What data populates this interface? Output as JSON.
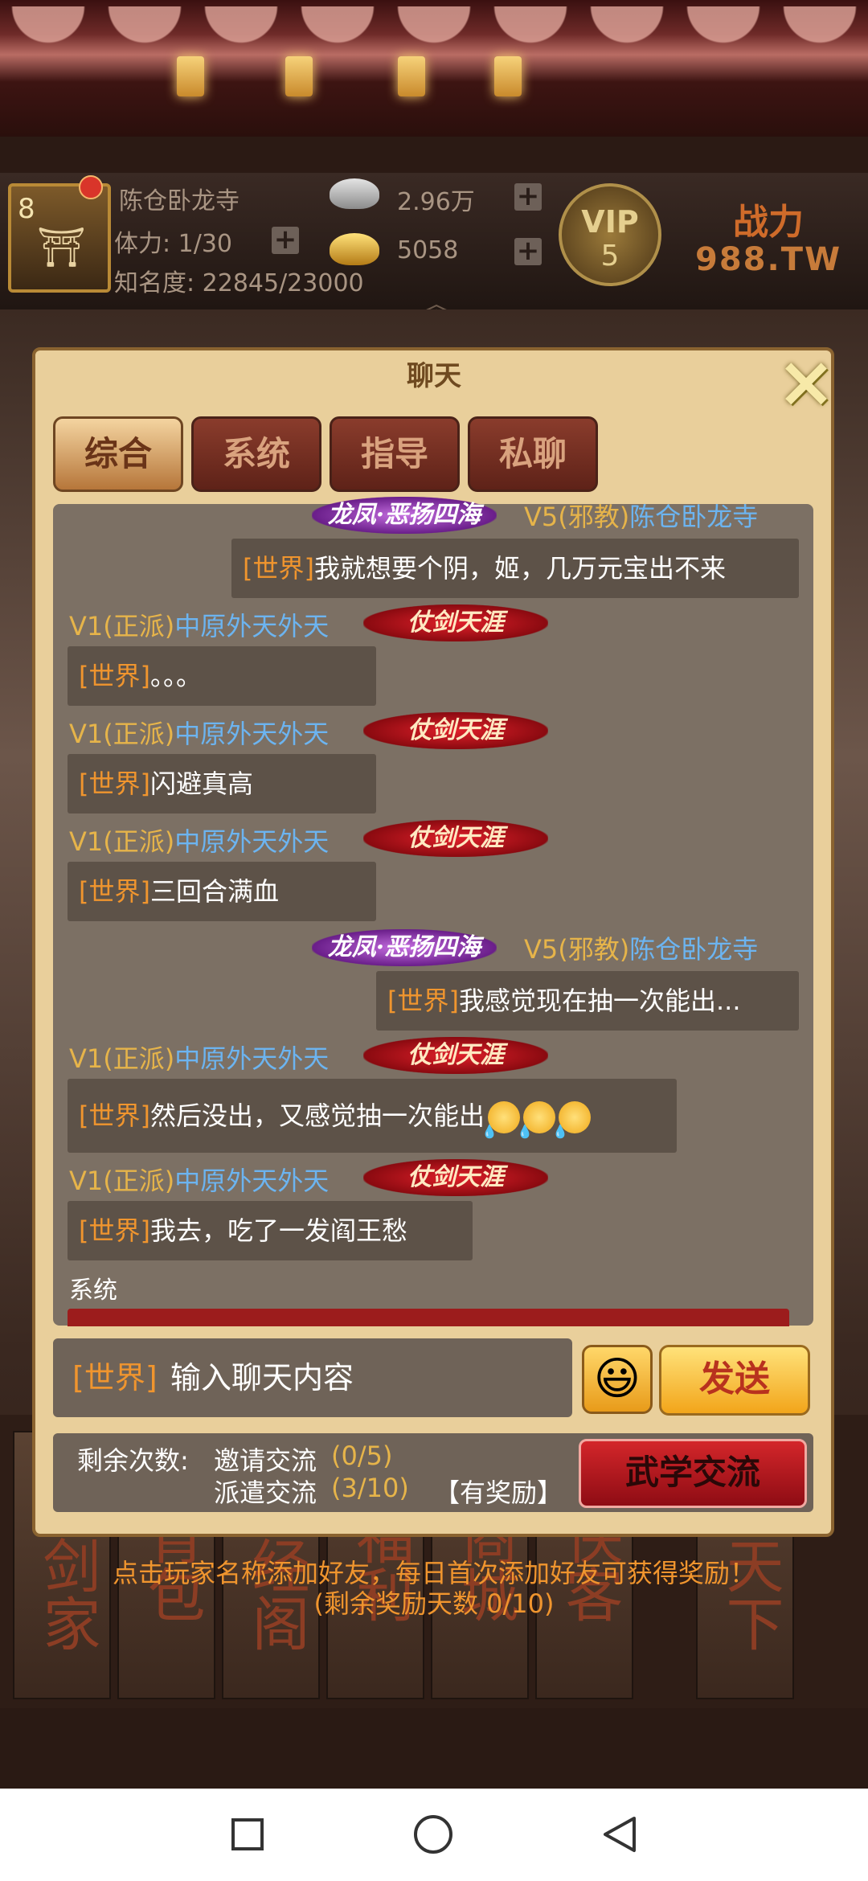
{
  "header": {
    "level": "8",
    "player_name": "陈仓卧龙寺",
    "stamina": "体力: 1/30",
    "fame": "知名度: 22845/23000",
    "silver": "2.96万",
    "gold": "5058",
    "vip_label": "VIP",
    "vip_level": "5",
    "power_label": "战力",
    "power_site": "988.TW"
  },
  "dialog": {
    "title": "聊天",
    "close_icon": "×",
    "tabs": [
      "综合",
      "系统",
      "指导",
      "私聊"
    ]
  },
  "chat": {
    "m0_title": "龙凤·恶扬四海",
    "m0_vip": "V5(邪教)",
    "m0_name": "陈仓卧龙寺",
    "m0_tag": "[世界]",
    "m0_text": "我就想要个阴，姬，几万元宝出不来",
    "m1_vip": "V1(正派)",
    "m1_name": "中原外天外天",
    "m1_title": "仗剑天涯",
    "m1_tag": "[世界]",
    "m1_text": "。。。",
    "m2_vip": "V1(正派)",
    "m2_name": "中原外天外天",
    "m2_title": "仗剑天涯",
    "m2_tag": "[世界]",
    "m2_text": "闪避真高",
    "m3_vip": "V1(正派)",
    "m3_name": "中原外天外天",
    "m3_title": "仗剑天涯",
    "m3_tag": "[世界]",
    "m3_text": "三回合满血",
    "m4_title": "龙凤·恶扬四海",
    "m4_vip": "V5(邪教)",
    "m4_name": "陈仓卧龙寺",
    "m4_tag": "[世界]",
    "m4_text": "我感觉现在抽一次能出...",
    "m5_vip": "V1(正派)",
    "m5_name": "中原外天外天",
    "m5_title": "仗剑天涯",
    "m5_tag": "[世界]",
    "m5_text": "然后没出，又感觉抽一次能出",
    "m6_vip": "V1(正派)",
    "m6_name": "中原外天外天",
    "m6_title": "仗剑天涯",
    "m6_tag": "[世界]",
    "m6_text": "我去，吃了一发阎王愁",
    "system_label": "系统"
  },
  "input": {
    "channel": "[世界]",
    "placeholder": "输入聊天内容",
    "emoji_icon": "😃",
    "send_label": "发送"
  },
  "exchange": {
    "remaining_label": "剩余次数:",
    "invite_label": "邀请交流",
    "invite_count": "(0/5)",
    "dispatch_label": "派遣交流",
    "dispatch_count": "(3/10)",
    "reward_label": "【有奖励】",
    "martial_button": "武学交流"
  },
  "notice": {
    "line1": "点击玩家名称添加好友，每日首次添加好友可获得奖励！",
    "line2": "(剩余奖励天数 0/10)"
  },
  "bottom_tiles": [
    "大剑家",
    "背包",
    "藏经阁",
    "福利",
    "商城",
    "侠客",
    "剑天下"
  ]
}
